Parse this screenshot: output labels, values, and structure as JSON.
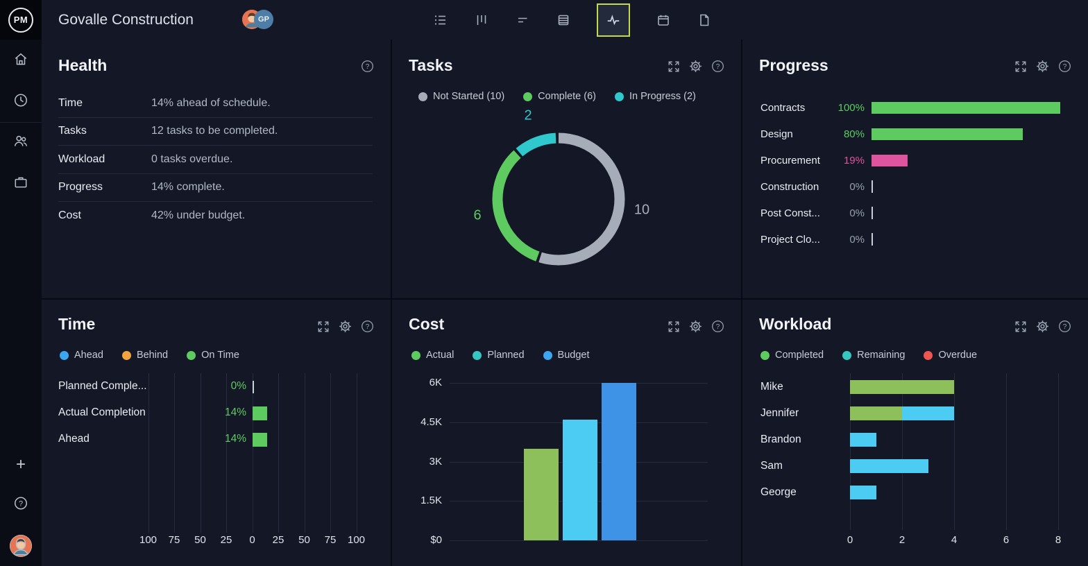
{
  "colors": {
    "green": "#5ecb61",
    "chart_green": "#8dc05a",
    "teal": "#36c7c3",
    "donut_teal": "#2fc9cd",
    "cyan": "#4dccf3",
    "blue": "#3da6f2",
    "budget_blue": "#3e93e6",
    "orange": "#f2a43d",
    "red": "#ee574f",
    "pink": "#de549e",
    "gray": "#9aa3ad",
    "donut_gray": "#a6adb8",
    "accent_border": "#c6d84b"
  },
  "header": {
    "logo": "PM",
    "title": "Govalle Construction",
    "avatar_initials": "GP",
    "toolbar_icons": [
      "task-list",
      "kanban-board",
      "gantt",
      "sheet",
      "dashboard",
      "calendar",
      "files"
    ],
    "active_tool": "dashboard"
  },
  "sidebar": {
    "icons": [
      "home",
      "clock",
      "team",
      "portfolio"
    ],
    "footer_icons": [
      "add",
      "help"
    ]
  },
  "panels": {
    "health": {
      "title": "Health",
      "rows": [
        {
          "label": "Time",
          "value": "14% ahead of schedule."
        },
        {
          "label": "Tasks",
          "value": "12 tasks to be completed."
        },
        {
          "label": "Workload",
          "value": "0 tasks overdue."
        },
        {
          "label": "Progress",
          "value": "14% complete."
        },
        {
          "label": "Cost",
          "value": "42% under budget."
        }
      ]
    },
    "tasks": {
      "title": "Tasks",
      "legend": [
        {
          "label": "Not Started (10)",
          "color": "#a6adb8"
        },
        {
          "label": "Complete (6)",
          "color": "#5ecb61"
        },
        {
          "label": "In Progress (2)",
          "color": "#2fc9cd"
        }
      ],
      "chart": {
        "type": "donut",
        "total": 18,
        "segments": [
          {
            "name": "Not Started",
            "value": 10,
            "label": "10",
            "color": "#a6adb8"
          },
          {
            "name": "Complete",
            "value": 6,
            "label": "6",
            "color": "#5ecb61"
          },
          {
            "name": "In Progress",
            "value": 2,
            "label": "2",
            "color": "#2fc9cd"
          }
        ]
      }
    },
    "progress": {
      "title": "Progress",
      "rows": [
        {
          "label": "Contracts",
          "pct": 100,
          "pct_label": "100%",
          "color": "#5ecb61"
        },
        {
          "label": "Design",
          "pct": 80,
          "pct_label": "80%",
          "color": "#5ecb61"
        },
        {
          "label": "Procurement",
          "pct": 19,
          "pct_label": "19%",
          "color": "#de549e"
        },
        {
          "label": "Construction",
          "pct": 0,
          "pct_label": "0%",
          "color": "#98a0ad"
        },
        {
          "label": "Post Const...",
          "pct": 0,
          "pct_label": "0%",
          "color": "#98a0ad"
        },
        {
          "label": "Project Clo...",
          "pct": 0,
          "pct_label": "0%",
          "color": "#98a0ad"
        }
      ]
    },
    "time": {
      "title": "Time",
      "legend": [
        {
          "label": "Ahead",
          "color": "#3da6f2"
        },
        {
          "label": "Behind",
          "color": "#f2a43d"
        },
        {
          "label": "On Time",
          "color": "#5ecb61"
        }
      ],
      "axis_ticks": [
        "100",
        "75",
        "50",
        "25",
        "0",
        "25",
        "50",
        "75",
        "100"
      ],
      "rows": [
        {
          "label": "Planned Comple...",
          "pct": 0,
          "pct_label": "0%"
        },
        {
          "label": "Actual Completion",
          "pct": 14,
          "pct_label": "14%"
        },
        {
          "label": "Ahead",
          "pct": 14,
          "pct_label": "14%"
        }
      ],
      "bar_color": "#5ecb61"
    },
    "cost": {
      "title": "Cost",
      "legend": [
        {
          "label": "Actual",
          "color": "#5ecb61"
        },
        {
          "label": "Planned",
          "color": "#36c7c3"
        },
        {
          "label": "Budget",
          "color": "#3da6f2"
        }
      ],
      "y_ticks": [
        "6K",
        "4.5K",
        "3K",
        "1.5K",
        "$0"
      ],
      "y_max": 6000,
      "bars": [
        {
          "name": "Actual",
          "value": 3500,
          "color": "#8dc05a"
        },
        {
          "name": "Planned",
          "value": 4600,
          "color": "#4dccf3"
        },
        {
          "name": "Budget",
          "value": 6000,
          "color": "#3e93e6"
        }
      ]
    },
    "workload": {
      "title": "Workload",
      "legend": [
        {
          "label": "Completed",
          "color": "#5ecb61"
        },
        {
          "label": "Remaining",
          "color": "#36c7c3"
        },
        {
          "label": "Overdue",
          "color": "#ee574f"
        }
      ],
      "x_ticks": [
        "0",
        "2",
        "4",
        "6",
        "8"
      ],
      "x_max": 8,
      "rows": [
        {
          "name": "Mike",
          "completed": 4,
          "remaining": 0
        },
        {
          "name": "Jennifer",
          "completed": 2,
          "remaining": 2
        },
        {
          "name": "Brandon",
          "completed": 0,
          "remaining": 1
        },
        {
          "name": "Sam",
          "completed": 0,
          "remaining": 3
        },
        {
          "name": "George",
          "completed": 0,
          "remaining": 1
        }
      ],
      "completed_color": "#8dc05a",
      "remaining_color": "#4dccf3"
    }
  }
}
